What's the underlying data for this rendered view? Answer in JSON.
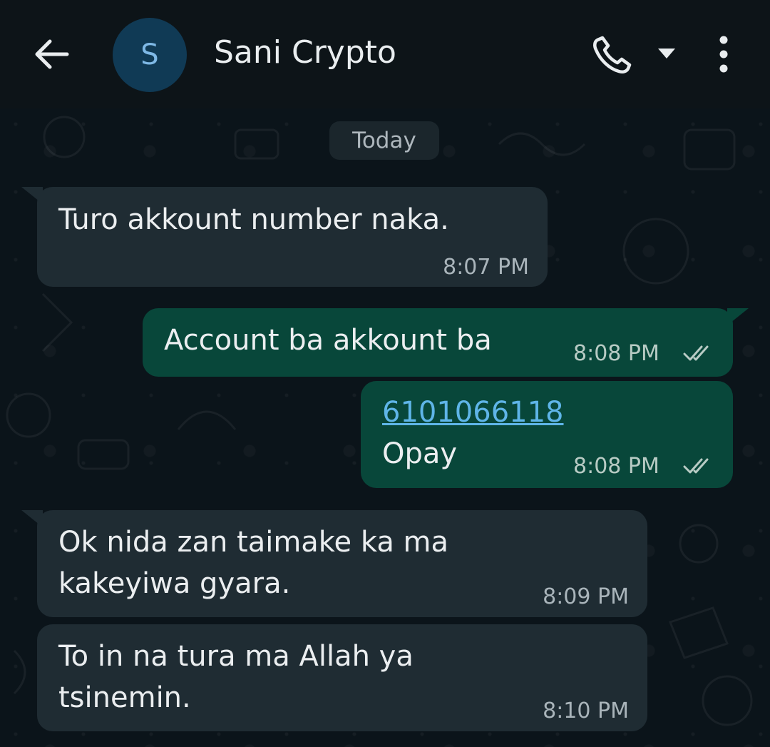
{
  "header": {
    "avatar_initial": "S",
    "contact_name": "Sani Crypto"
  },
  "chat": {
    "date_label": "Today",
    "messages": [
      {
        "direction": "incoming",
        "lines": [
          "Turo akkount number naka."
        ],
        "time": "8:07 PM"
      },
      {
        "direction": "outgoing",
        "lines": [
          "Account ba akkount ba"
        ],
        "time": "8:08 PM",
        "status": "read"
      },
      {
        "direction": "outgoing",
        "lines": [
          "6101066118",
          "Opay"
        ],
        "link": "6101066118",
        "time": "8:08 PM",
        "status": "read"
      },
      {
        "direction": "incoming",
        "lines": [
          "Ok nida zan taimake ka ma",
          "kakeyiwa gyara."
        ],
        "time": "8:09 PM"
      },
      {
        "direction": "incoming",
        "lines": [
          "To in na tura ma Allah ya",
          "tsinemin."
        ],
        "time": "8:10 PM"
      }
    ]
  },
  "colors": {
    "background": "#0b141a",
    "header": "#0d1418",
    "incoming_bubble": "#1f2c33",
    "outgoing_bubble": "#08473a",
    "link": "#5fb5e8",
    "avatar": "#103a55"
  },
  "icons": [
    "back-arrow-icon",
    "phone-icon",
    "dropdown-caret-icon",
    "more-options-icon",
    "read-ticks-icon"
  ]
}
